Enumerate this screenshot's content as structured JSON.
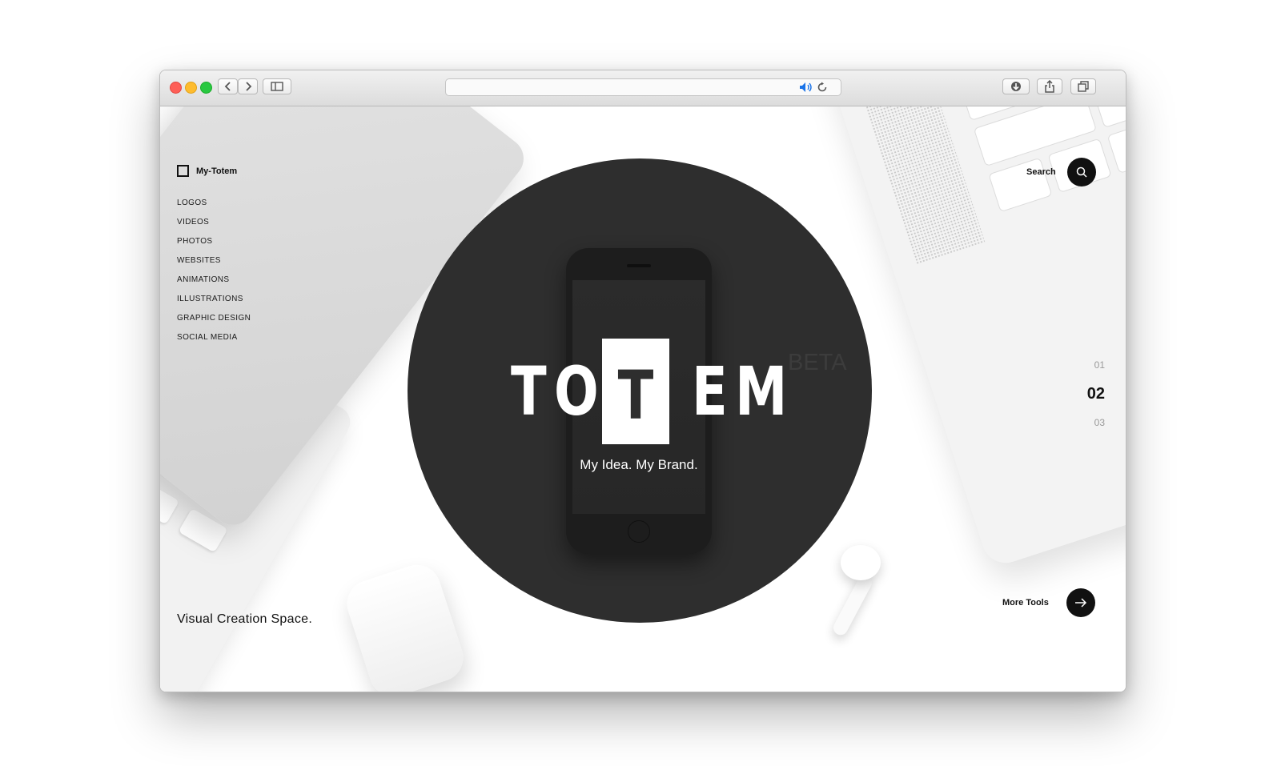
{
  "brand": {
    "name": "My-Totem"
  },
  "nav": {
    "items": [
      {
        "label": "LOGOS"
      },
      {
        "label": "VIDEOS"
      },
      {
        "label": "PHOTOS"
      },
      {
        "label": "WEBSITES"
      },
      {
        "label": "ANIMATIONS"
      },
      {
        "label": "ILLUSTRATIONS"
      },
      {
        "label": "GRAPHIC DESIGN"
      },
      {
        "label": "SOCIAL MEDIA"
      }
    ]
  },
  "hero": {
    "logo_left": "TO",
    "logo_box_letter": "T",
    "logo_right": "EM",
    "badge": "BETA",
    "tagline": "My Idea. My Brand."
  },
  "search": {
    "label": "Search",
    "icon": "search-icon"
  },
  "pager": {
    "items": [
      {
        "label": "01",
        "active": false
      },
      {
        "label": "02",
        "active": true
      },
      {
        "label": "03",
        "active": false
      }
    ]
  },
  "footer": {
    "slogan": "Visual Creation Space.",
    "more_label": "More Tools",
    "more_icon": "arrow-right-icon"
  },
  "colors": {
    "circle": "#2e2e2e",
    "accent": "#111111",
    "toolbar_audio": "#1a73e8"
  }
}
